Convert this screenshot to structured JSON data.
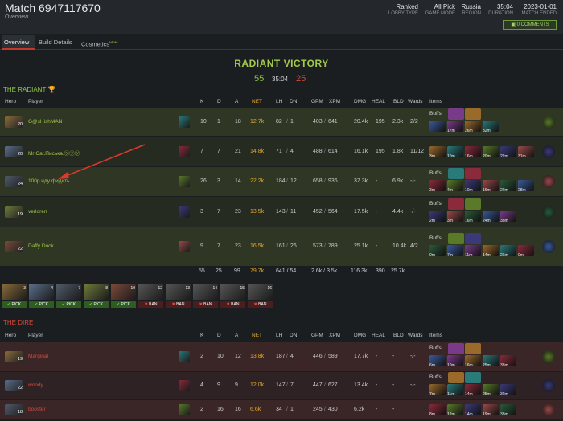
{
  "header": {
    "title": "Match 6947117670",
    "subtitle": "Overview",
    "meta": [
      {
        "value": "Ranked",
        "label": "LOBBY TYPE"
      },
      {
        "value": "All Pick",
        "label": "GAME MODE"
      },
      {
        "value": "Russia",
        "label": "REGION"
      },
      {
        "value": "35:04",
        "label": "DURATION"
      },
      {
        "value": "2023-01-01",
        "label": "MATCH ENDED"
      }
    ],
    "comments_label": "0 COMMENTS"
  },
  "tabs": [
    {
      "label": "Overview"
    },
    {
      "label": "Build Details"
    },
    {
      "label": "Cosmetics",
      "badge": "NEW!"
    }
  ],
  "result": {
    "victory": "RADIANT VICTORY",
    "radiant_score": "55",
    "duration": "35:04",
    "dire_score": "25"
  },
  "columns": [
    "Hero",
    "Player",
    "K",
    "D",
    "A",
    "NET",
    "LH",
    "DN",
    "GPM",
    "XPM",
    "DMG",
    "HEAL",
    "BLD",
    "Wards",
    "Items"
  ],
  "radiant": {
    "title": "THE RADIANT",
    "trophy_icon": "trophy-icon",
    "players": [
      {
        "level": "20",
        "name": "G@sHishMAN",
        "k": "10",
        "d": "1",
        "a": "18",
        "net": "12.7k",
        "lh": "82",
        "dn": "1",
        "gpm": "403",
        "xpm": "641",
        "dmg": "20.4k",
        "heal": "195",
        "bld": "2.3k",
        "wards": "2/2",
        "buffs": "Buffs:",
        "times": [
          "",
          "17m",
          "26m",
          "32m"
        ]
      },
      {
        "level": "20",
        "name": "Mr Cat.Писька.㋡㋡㋡",
        "k": "7",
        "d": "7",
        "a": "21",
        "net": "14.8k",
        "lh": "71",
        "dn": "4",
        "gpm": "488",
        "xpm": "614",
        "dmg": "16.1k",
        "heal": "195",
        "bld": "1.8k",
        "wards": "11/12",
        "buffs": "",
        "times": [
          "3m",
          "10m",
          "16m",
          "20m",
          "22m",
          "31m"
        ]
      },
      {
        "level": "24",
        "name": "100р иду фидить",
        "k": "26",
        "d": "3",
        "a": "14",
        "net": "22.2k",
        "lh": "184",
        "dn": "12",
        "gpm": "658",
        "xpm": "936",
        "dmg": "37.3k",
        "heal": "-",
        "bld": "6.9k",
        "wards": "-/-",
        "buffs": "Buffs:",
        "times": [
          "3m",
          "4m",
          "10m",
          "16m",
          "22m",
          "28m"
        ]
      },
      {
        "level": "19",
        "name": "verloren",
        "k": "3",
        "d": "7",
        "a": "23",
        "net": "13.5k",
        "lh": "143",
        "dn": "11",
        "gpm": "452",
        "xpm": "564",
        "dmg": "17.5k",
        "heal": "-",
        "bld": "4.4k",
        "wards": "-/-",
        "buffs": "Buffs:",
        "times": [
          "2m",
          "3m",
          "16m",
          "24m",
          "33m"
        ]
      },
      {
        "level": "22",
        "name": "Daffy Duck",
        "k": "9",
        "d": "7",
        "a": "23",
        "net": "16.5k",
        "lh": "161",
        "dn": "26",
        "gpm": "573",
        "xpm": "789",
        "dmg": "25.1k",
        "heal": "-",
        "bld": "10.4k",
        "wards": "4/2",
        "buffs": "Buffs:",
        "times": [
          "0m",
          "7m",
          "11m",
          "14m",
          "26m",
          "0m"
        ]
      }
    ],
    "totals": {
      "k": "55",
      "d": "25",
      "a": "99",
      "net": "79.7k",
      "lhdn": "641 / 54",
      "gpmxpm": "2.6k / 3.5k",
      "dmg": "116.3k",
      "heal": "390",
      "bld": "25.7k"
    }
  },
  "draft": [
    {
      "num": "3",
      "type": "PICK"
    },
    {
      "num": "4",
      "type": "PICK"
    },
    {
      "num": "7",
      "type": "PICK"
    },
    {
      "num": "8",
      "type": "PICK"
    },
    {
      "num": "10",
      "type": "PICK"
    },
    {
      "num": "12",
      "type": "BAN"
    },
    {
      "num": "13",
      "type": "BAN"
    },
    {
      "num": "14",
      "type": "BAN"
    },
    {
      "num": "15",
      "type": "BAN"
    },
    {
      "num": "16",
      "type": "BAN"
    }
  ],
  "dire": {
    "title": "THE DIRE",
    "players": [
      {
        "level": "19",
        "name": "Marginal",
        "k": "2",
        "d": "10",
        "a": "12",
        "net": "13.8k",
        "lh": "187",
        "dn": "4",
        "gpm": "446",
        "xpm": "589",
        "dmg": "17.7k",
        "heal": "-",
        "bld": "-",
        "wards": "-/-",
        "buffs": "Buffs:",
        "times": [
          "6m",
          "10m",
          "16m",
          "25m",
          "33m"
        ]
      },
      {
        "level": "22",
        "name": "woody",
        "k": "4",
        "d": "9",
        "a": "9",
        "net": "12.0k",
        "lh": "147",
        "dn": "7",
        "gpm": "447",
        "xpm": "627",
        "dmg": "13.4k",
        "heal": "-",
        "bld": "-",
        "wards": "-/-",
        "buffs": "Buffs:",
        "times": [
          "7m",
          "11m",
          "14m",
          "25m",
          "32m"
        ]
      },
      {
        "level": "18",
        "name": "booster",
        "k": "2",
        "d": "16",
        "a": "16",
        "net": "6.6k",
        "lh": "34",
        "dn": "1",
        "gpm": "245",
        "xpm": "430",
        "dmg": "6.2k",
        "heal": "-",
        "bld": "-",
        "wards": "",
        "buffs": "",
        "times": [
          "8m",
          "12m",
          "14m",
          "19m",
          "33m"
        ]
      }
    ]
  },
  "colors": {
    "accent": "#a3c94a",
    "net": "#e0a72a",
    "dire": "#d24b3c",
    "radiant": "#8fc544"
  }
}
